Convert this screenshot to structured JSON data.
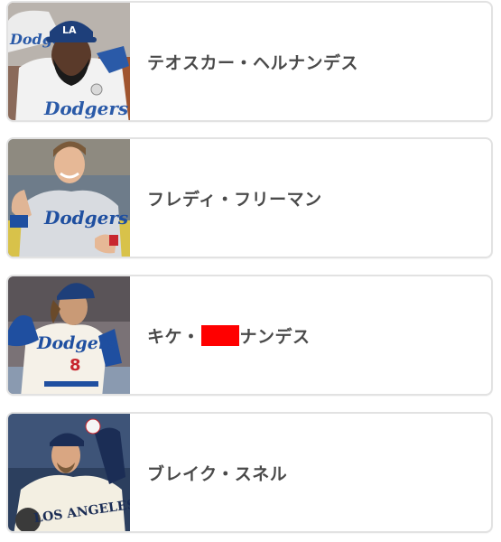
{
  "players": [
    {
      "name": "テオスカー・ヘルナンデス",
      "photo_icon": "player-photo-hernandez"
    },
    {
      "name": "フレディ・フリーマン",
      "photo_icon": "player-photo-freeman"
    },
    {
      "name_before": "キケ・",
      "name_after": "ナンデス",
      "photo_icon": "player-photo-kike"
    },
    {
      "name": "ブレイク・スネル",
      "photo_icon": "player-photo-snell"
    }
  ],
  "photo_text": {
    "jersey_dodgers": "Dodgers",
    "jersey_los_angeles": "LOS ANGELES",
    "cap_la": "LA",
    "number_8": "8"
  },
  "colors": {
    "border": "#e2e2e2",
    "text": "#4a4a4a",
    "redaction": "#ff0000",
    "dodger_blue": "#1f4fa0"
  }
}
